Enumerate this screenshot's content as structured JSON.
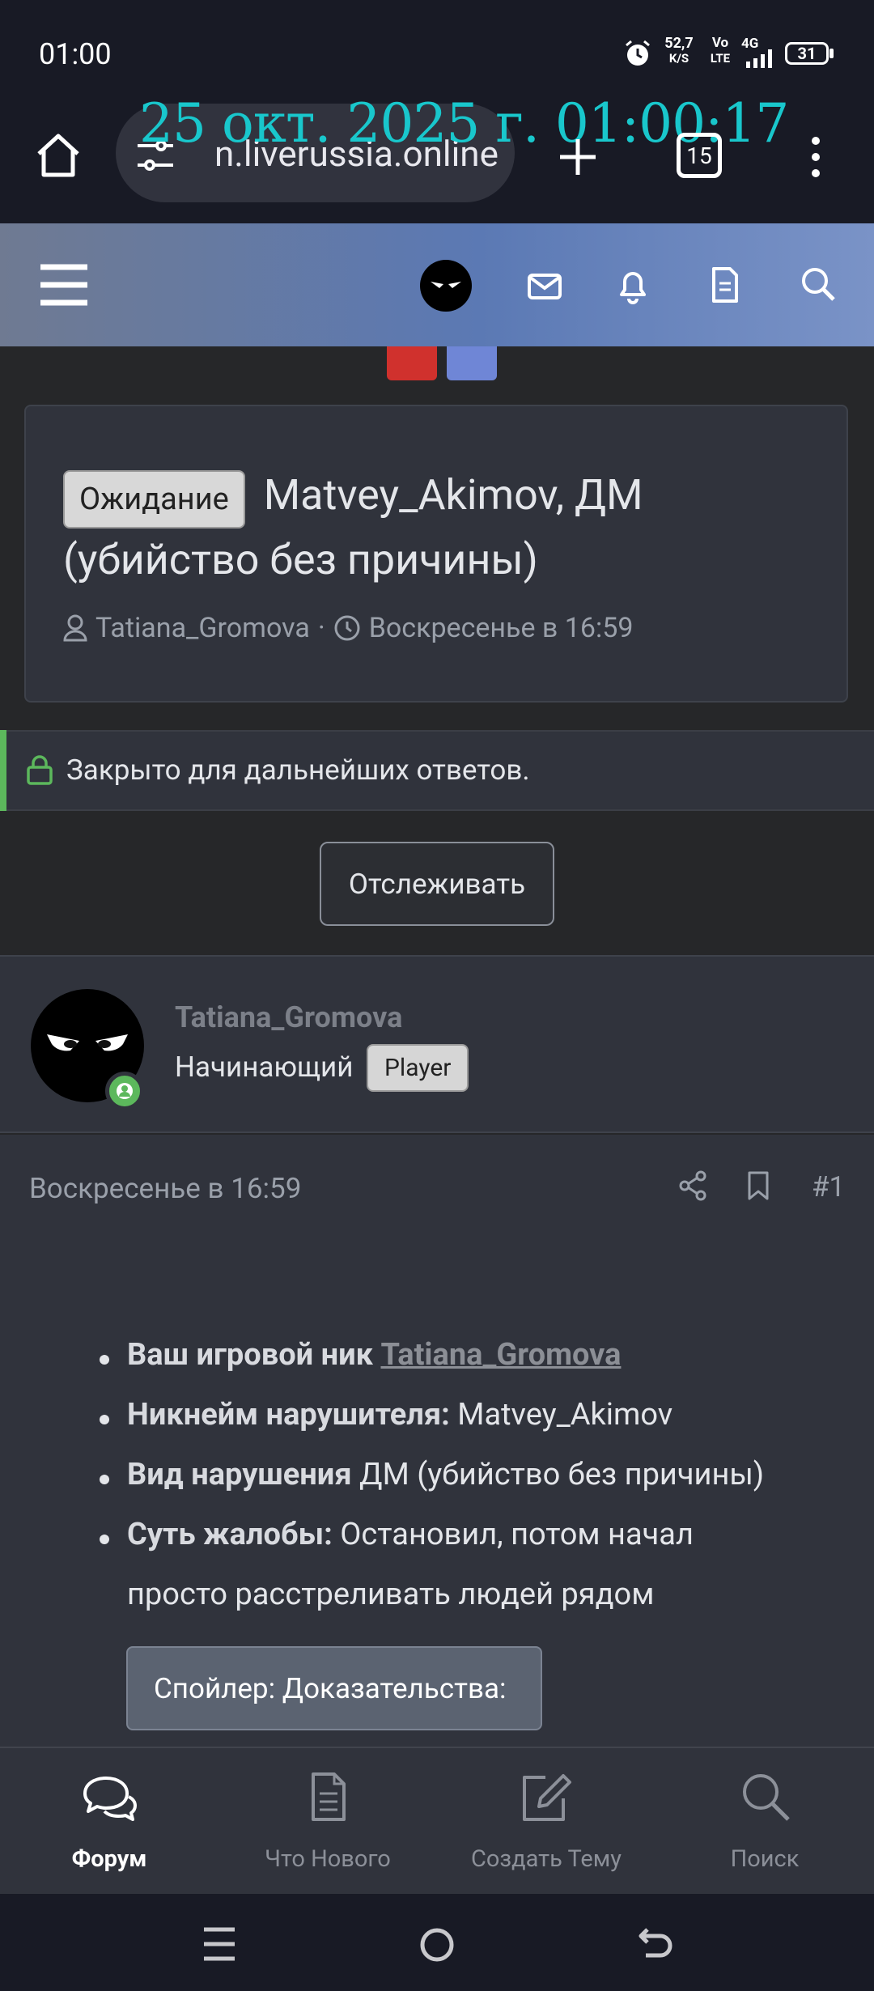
{
  "status": {
    "time": "01:00",
    "net_speed_top": "52,7",
    "net_speed_bottom": "K/S",
    "volte_top": "Vo",
    "volte_bottom": "LTE",
    "network": "4G",
    "battery": "31"
  },
  "browser": {
    "url": "n.liverussia.online",
    "tab_count": "15",
    "timestamp_overlay": "25 окт. 2025 г. 01:00:17"
  },
  "thread": {
    "prefix": "Ожидание",
    "title_part1": "Matvey_Akimov, ДМ",
    "title_part2": "(убийство без причины)",
    "author": "Tatiana_Gromova",
    "separator": "·",
    "date": "Воскресенье в 16:59"
  },
  "closed_notice": "Закрыто для дальнейших ответов.",
  "watch_button": "Отслеживать",
  "post": {
    "username": "Tatiana_Gromova",
    "user_title": "Начинающий",
    "user_badge": "Player",
    "date": "Воскресенье в 16:59",
    "number": "#1",
    "fields": [
      {
        "label": "Ваш игровой ник",
        "value": "Tatiana_Gromova"
      },
      {
        "label": "Никнейм нарушителя:",
        "value": "Matvey_Akimov"
      },
      {
        "label": "Вид нарушения",
        "value": "ДМ (убийство без причины)"
      },
      {
        "label": "Суть жалобы:",
        "value": "Остановил, потом начал",
        "value_line2": "просто расстреливать людей рядом"
      }
    ],
    "spoiler": "Спойлер: Доказательства:"
  },
  "bottom_nav": [
    {
      "label": "Форум",
      "icon": "chat-bubbles-icon",
      "active": true
    },
    {
      "label": "Что Нового",
      "icon": "document-icon",
      "active": false
    },
    {
      "label": "Создать Тему",
      "icon": "edit-icon",
      "active": false
    },
    {
      "label": "Поиск",
      "icon": "search-icon",
      "active": false
    }
  ],
  "colors": {
    "accent_green": "#5cb85c",
    "header_gradient_start": "#6f7a92",
    "header_gradient_end": "#7a93c7",
    "timestamp_color": "#19c7cc"
  }
}
